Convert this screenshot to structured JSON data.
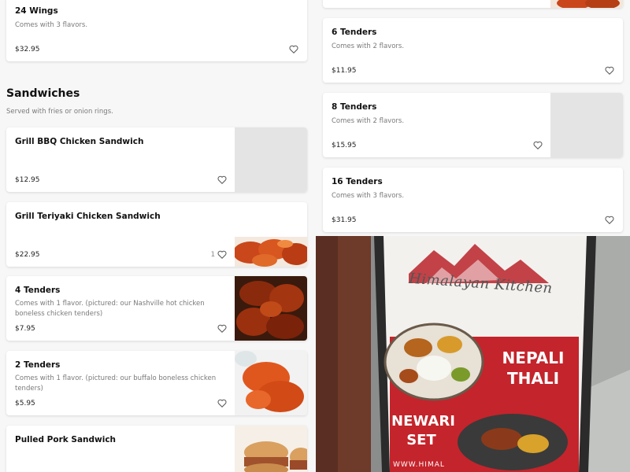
{
  "left_column": {
    "card_24_wings": {
      "title": "24 Wings",
      "description": "Comes with 3 flavors.",
      "price": "$32.95"
    },
    "sandwiches": {
      "title": "Sandwiches",
      "description": "Served with fries or onion rings."
    },
    "card_bbq": {
      "title": "Grill BBQ Chicken Sandwich",
      "price": "$12.95"
    },
    "card_teriyaki": {
      "title": "Grill Teriyaki Chicken Sandwich",
      "price": "$22.95",
      "like_count": "1"
    },
    "card_4_tenders": {
      "title": "4 Tenders",
      "description": "Comes with 1 flavor. (pictured: our Nashville hot chicken boneless chicken tenders)",
      "price": "$7.95"
    },
    "card_2_tenders": {
      "title": "2 Tenders",
      "description": "Comes with 1 flavor. (pictured: our buffalo boneless chicken tenders)",
      "price": "$5.95"
    },
    "card_pulled_pork": {
      "title": "Pulled Pork Sandwich"
    }
  },
  "right_column": {
    "card_6_tenders": {
      "title": "6 Tenders",
      "description": "Comes with 2 flavors.",
      "price": "$11.95"
    },
    "card_8_tenders": {
      "title": "8 Tenders",
      "description": "Comes with 2 flavors.",
      "price": "$15.95"
    },
    "card_16_tenders": {
      "title": "16 Tenders",
      "description": "Comes with 3 flavors.",
      "price": "$31.95"
    }
  },
  "banner": {
    "brand": "Himalayan Kitchen",
    "nepali_label": "NEPALI THALI",
    "nepali_line1": "NEPALI",
    "nepali_line2": "THALI",
    "newari_label": "NEWARI SET",
    "newari_line1": "NEWARI",
    "newari_line2": "SET",
    "url": "WWW.HIMAL"
  },
  "icons": {
    "heart": "heart-outline-icon"
  },
  "colors": {
    "accent_red": "#c4242b",
    "text": "#111111",
    "muted": "#7a7a7a",
    "card_bg": "#ffffff",
    "page_bg": "#f7f7f7"
  }
}
